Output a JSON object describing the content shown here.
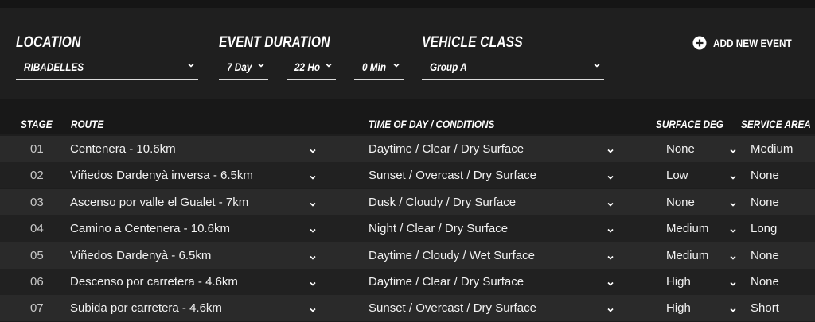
{
  "filters": {
    "location": {
      "label": "LOCATION",
      "value": "RIBADELLES"
    },
    "event_duration": {
      "label": "EVENT DURATION",
      "days": "7 Day",
      "hours": "22 Ho",
      "minutes": "0 Min"
    },
    "vehicle_class": {
      "label": "VEHICLE CLASS",
      "value": "Group A"
    },
    "add_new_event": "ADD NEW EVENT"
  },
  "table": {
    "headers": {
      "stage": "STAGE",
      "route": "ROUTE",
      "conditions": "TIME OF DAY / CONDITIONS",
      "surface_deg": "SURFACE DEG",
      "service_area": "SERVICE AREA"
    },
    "rows": [
      {
        "stage": "01",
        "route": "Centenera - 10.6km",
        "conditions": "Daytime / Clear / Dry Surface",
        "surface": "None",
        "service": "Medium"
      },
      {
        "stage": "02",
        "route": "Viñedos Dardenyà inversa - 6.5km",
        "conditions": "Sunset / Overcast / Dry Surface",
        "surface": "Low",
        "service": "None"
      },
      {
        "stage": "03",
        "route": "Ascenso por valle el Gualet - 7km",
        "conditions": "Dusk / Cloudy / Dry Surface",
        "surface": "None",
        "service": "None"
      },
      {
        "stage": "04",
        "route": "Camino a Centenera - 10.6km",
        "conditions": "Night / Clear / Dry Surface",
        "surface": "Medium",
        "service": "Long"
      },
      {
        "stage": "05",
        "route": "Viñedos Dardenyà - 6.5km",
        "conditions": "Daytime / Cloudy / Wet Surface",
        "surface": "Medium",
        "service": "None"
      },
      {
        "stage": "06",
        "route": "Descenso por carretera - 4.6km",
        "conditions": "Daytime / Clear / Dry Surface",
        "surface": "High",
        "service": "None"
      },
      {
        "stage": "07",
        "route": "Subida por carretera - 4.6km",
        "conditions": "Sunset / Overcast / Dry Surface",
        "surface": "High",
        "service": "Short"
      }
    ]
  },
  "icons": {
    "dropdown": "chevron-down-icon",
    "add": "plus-circle-icon"
  },
  "colors": {
    "background": "#1e1e1e",
    "row_odd": "#2a2a2a",
    "row_even": "#212121",
    "text": "#ffffff"
  }
}
